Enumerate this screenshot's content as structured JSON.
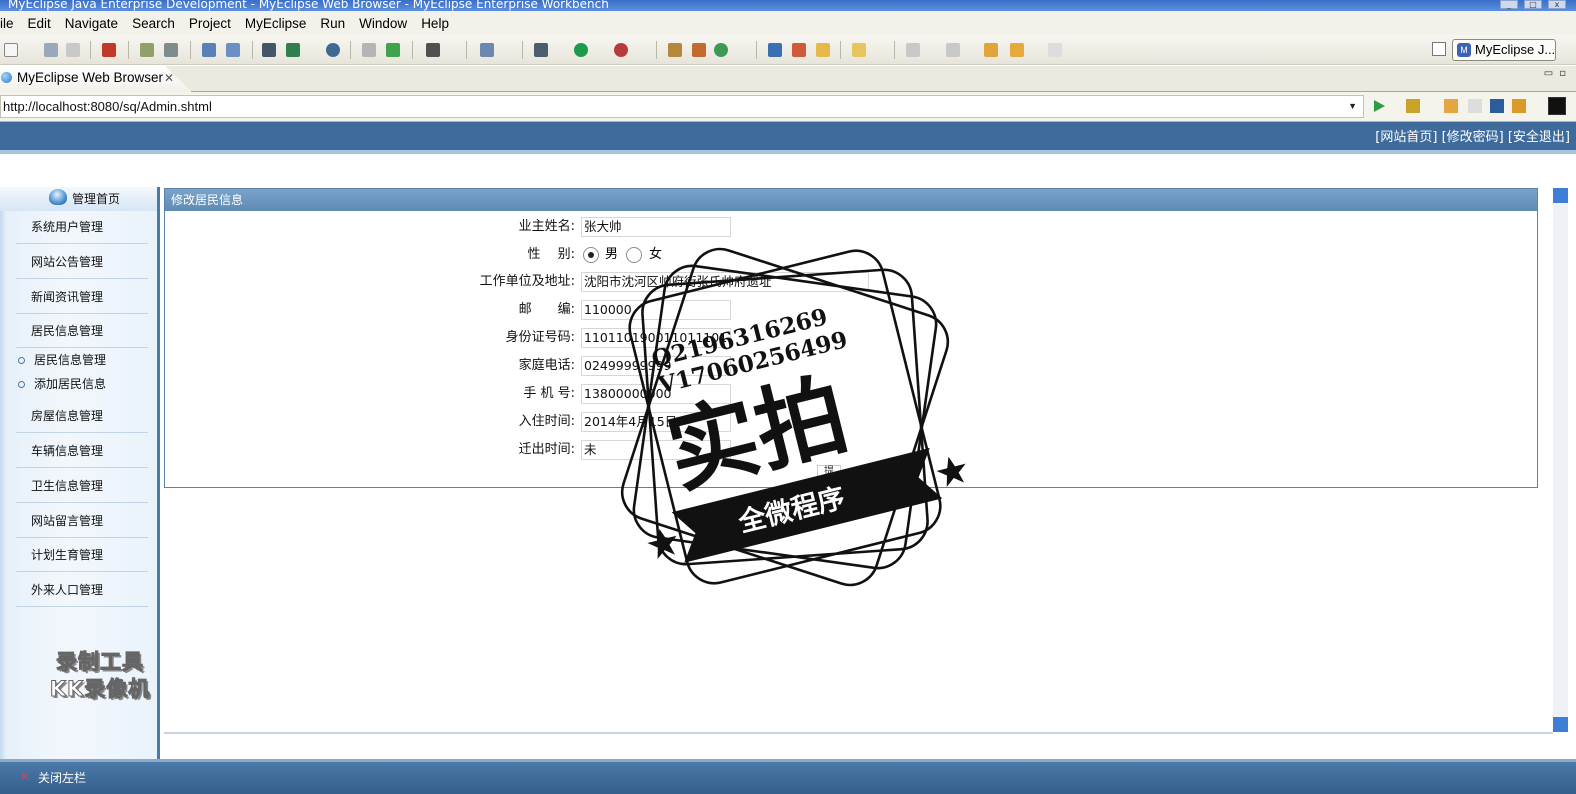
{
  "window": {
    "title": "MyEclipse Java Enterprise Development - MyEclipse Web Browser - MyEclipse Enterprise Workbench"
  },
  "menu": [
    "ile",
    "Edit",
    "Navigate",
    "Search",
    "Project",
    "MyEclipse",
    "Run",
    "Window",
    "Help"
  ],
  "perspective": {
    "label": "MyEclipse J..."
  },
  "tab": {
    "label": "MyEclipse Web Browser"
  },
  "url": "http://localhost:8080/sq/Admin.shtml",
  "top_links": "[网站首页] [修改密码] [安全退出]",
  "sidebar": {
    "header": "管理首页",
    "items": [
      "系统用户管理",
      "网站公告管理",
      "新闻资讯管理",
      "居民信息管理"
    ],
    "subitems": [
      "居民信息管理",
      "添加居民信息"
    ],
    "items2": [
      "房屋信息管理",
      "车辆信息管理",
      "卫生信息管理",
      "网站留言管理",
      "计划生育管理",
      "外来人口管理"
    ]
  },
  "form": {
    "title": "修改居民信息",
    "fields": {
      "name_label": "业主姓名:",
      "name_value": "张大帅",
      "gender_label": "性　 别:",
      "gender_male": "男",
      "gender_female": "女",
      "gender_selected": "男",
      "work_label": "工作单位及地址:",
      "work_value": "沈阳市沈河区帅府街张氏帅府遗址",
      "zip_label": "邮　　编:",
      "zip_value": "110000",
      "id_label": "身份证号码:",
      "id_value": "110110190011011101101",
      "phone_label": "家庭电话:",
      "phone_value": "02499999999",
      "mobile_label": "手 机 号:",
      "mobile_value": "13800000000",
      "movein_label": "入住时间:",
      "movein_value": "2014年4月15日",
      "moveout_label": "迁出时间:",
      "moveout_value": "未"
    },
    "submit_partial": "提"
  },
  "status": {
    "close_left": "关闭左栏"
  },
  "watermark_recorder": {
    "line1": "录制工具",
    "line2": "KK录像机"
  },
  "stamp": {
    "qq": "Q2196316269",
    "wechat": "V17060256499",
    "big": "实拍",
    "banner": "全微程序"
  },
  "colors": {
    "header_blue": "#3e6b9c",
    "panel_blue": "#6a94bc",
    "status_blue": "#3f6c9b"
  }
}
